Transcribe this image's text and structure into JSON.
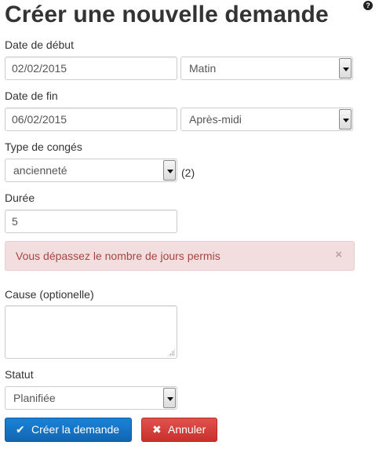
{
  "page": {
    "title": "Créer une nouvelle demande",
    "help_icon": "question-circle-icon"
  },
  "form": {
    "start_date": {
      "label": "Date de début",
      "value": "02/02/2015",
      "half": "Matin"
    },
    "end_date": {
      "label": "Date de fin",
      "value": "06/02/2015",
      "half": "Après-midi"
    },
    "leave_type": {
      "label": "Type de congés",
      "value": "ancienneté",
      "count": "(2)"
    },
    "duration": {
      "label": "Durée",
      "value": "5"
    },
    "alert": {
      "message": "Vous dépassez le nombre de jours permis",
      "close": "×"
    },
    "cause": {
      "label": "Cause (optionelle)",
      "value": ""
    },
    "status": {
      "label": "Statut",
      "value": "Planifiée"
    }
  },
  "actions": {
    "create": {
      "label": "Créer la demande",
      "icon": "check-icon"
    },
    "cancel": {
      "label": "Annuler",
      "icon": "times-icon"
    }
  },
  "colors": {
    "primary": "#1a82d6",
    "danger": "#d9534f",
    "alert_bg": "#f2dede",
    "alert_text": "#a94442"
  }
}
